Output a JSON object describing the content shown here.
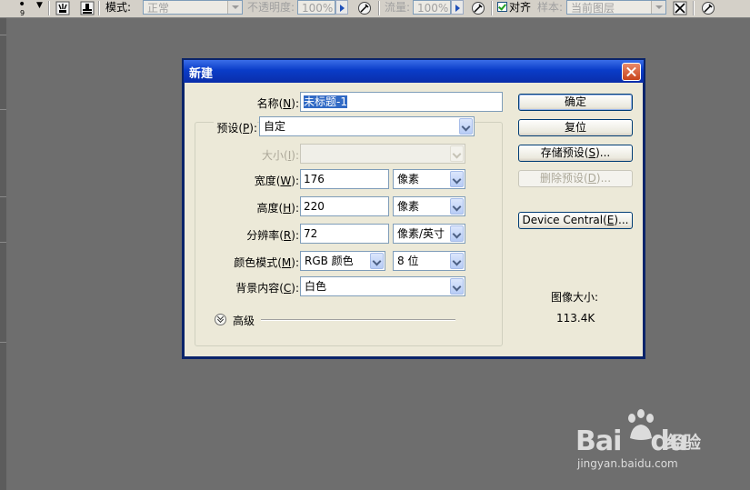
{
  "options_bar": {
    "brush_size": "9",
    "mode_label": "模式:",
    "mode_value": "正常",
    "opacity_label": "不透明度:",
    "opacity_value": "100%",
    "flow_label": "流量:",
    "flow_value": "100%",
    "aligned_label": "对齐",
    "aligned_checked": true,
    "sample_label": "样本:",
    "sample_value": "当前图层"
  },
  "dialog": {
    "title": "新建",
    "name_label": "名称(",
    "name_key": "N",
    "name_suffix": "):",
    "name_value": "未标题-1",
    "preset_label": "预设(",
    "preset_key": "P",
    "preset_suffix": "):",
    "preset_value": "自定",
    "size_label": "大小(",
    "size_key": "I",
    "size_suffix": "):",
    "size_value": "",
    "width_label": "宽度(",
    "width_key": "W",
    "width_suffix": "):",
    "width_value": "176",
    "width_unit": "像素",
    "height_label": "高度(",
    "height_key": "H",
    "height_suffix": "):",
    "height_value": "220",
    "height_unit": "像素",
    "resolution_label": "分辨率(",
    "resolution_key": "R",
    "resolution_suffix": "):",
    "resolution_value": "72",
    "resolution_unit": "像素/英寸",
    "color_mode_label": "颜色模式(",
    "color_mode_key": "M",
    "color_mode_suffix": "):",
    "color_mode_value": "RGB 颜色",
    "bit_depth_value": "8 位",
    "background_label": "背景内容(",
    "background_key": "C",
    "background_suffix": "):",
    "background_value": "白色",
    "advanced_label": "高级",
    "buttons": {
      "ok": "确定",
      "reset": "复位",
      "save_preset_prefix": "存储预设(",
      "save_preset_key": "S",
      "save_preset_suffix": ")...",
      "delete_preset_prefix": "删除预设(",
      "delete_preset_key": "D",
      "delete_preset_suffix": ")...",
      "device_central_prefix": "Device Central(",
      "device_central_key": "E",
      "device_central_suffix": ")..."
    },
    "image_size_label": "图像大小:",
    "image_size_value": "113.4K"
  },
  "watermark": {
    "logo_text": "Bai",
    "logo_text_2": "du",
    "jingyan_text": "经验",
    "url": "jingyan.baidu.com"
  },
  "colors": {
    "titlebar": "#0a3cc8",
    "workspace": "#6e6e6e",
    "dialog_bg": "#ece9d8",
    "close_button": "#c8431b"
  }
}
